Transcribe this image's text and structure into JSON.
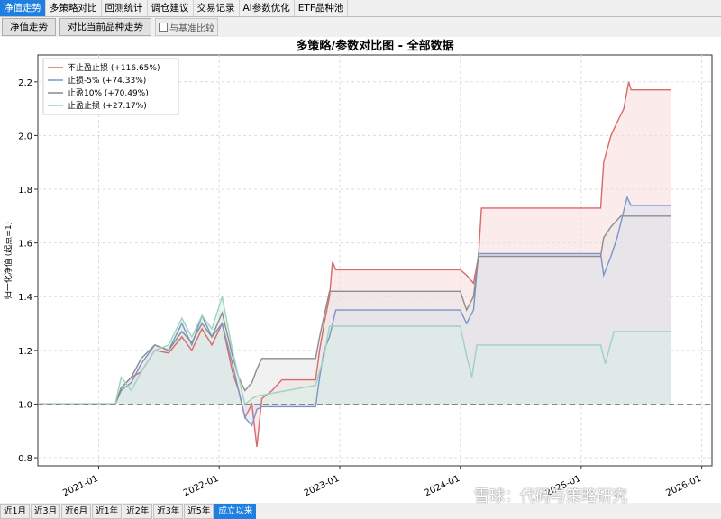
{
  "tabs": [
    {
      "label": "净值走势",
      "active": true
    },
    {
      "label": "多策略对比",
      "active": false
    },
    {
      "label": "回测统计",
      "active": false
    },
    {
      "label": "调仓建议",
      "active": false
    },
    {
      "label": "交易记录",
      "active": false
    },
    {
      "label": "AI参数优化",
      "active": false
    },
    {
      "label": "ETF品种池",
      "active": false
    }
  ],
  "toolbar": {
    "btn_nav": "净值走势",
    "btn_compare": "对比当前品种走势",
    "chk_benchmark": "与基准比较"
  },
  "ranges": [
    {
      "label": "近1月",
      "active": false
    },
    {
      "label": "近3月",
      "active": false
    },
    {
      "label": "近6月",
      "active": false
    },
    {
      "label": "近1年",
      "active": false
    },
    {
      "label": "近2年",
      "active": false
    },
    {
      "label": "近3年",
      "active": false
    },
    {
      "label": "近5年",
      "active": false
    },
    {
      "label": "成立以来",
      "active": true
    }
  ],
  "watermark": "雪球：代码与策略研究",
  "chart_data": {
    "type": "line",
    "title": "多策略/参数对比图 - 全部数据",
    "xlabel": "",
    "ylabel": "归一化净值 (起点=1)",
    "xlim": [
      "2020-07-01",
      "2026-02-01"
    ],
    "ylim": [
      0.77,
      2.3
    ],
    "yticks": [
      "0.8",
      "1.0",
      "1.2",
      "1.4",
      "1.6",
      "1.8",
      "2.0",
      "2.2"
    ],
    "xticks": [
      "2021-01",
      "2022-01",
      "2023-01",
      "2024-01",
      "2025-01",
      "2026-01"
    ],
    "baseline": 1.0,
    "grid": true,
    "legend_position": "top-left",
    "series": [
      {
        "name": "不止盈止损 (+116.65%)",
        "color": "#d9696b",
        "fill": "#f9dada",
        "points": [
          [
            "2020-07-01",
            1.0
          ],
          [
            "2021-02-20",
            1.0
          ],
          [
            "2021-03-10",
            1.06
          ],
          [
            "2021-04-10",
            1.1
          ],
          [
            "2021-05-10",
            1.12
          ],
          [
            "2021-06-20",
            1.2
          ],
          [
            "2021-08-01",
            1.19
          ],
          [
            "2021-09-10",
            1.25
          ],
          [
            "2021-10-10",
            1.2
          ],
          [
            "2021-11-10",
            1.28
          ],
          [
            "2021-12-10",
            1.22
          ],
          [
            "2022-01-10",
            1.3
          ],
          [
            "2022-02-10",
            1.12
          ],
          [
            "2022-03-01",
            1.05
          ],
          [
            "2022-03-20",
            0.95
          ],
          [
            "2022-04-10",
            1.0
          ],
          [
            "2022-04-25",
            0.84
          ],
          [
            "2022-05-10",
            1.02
          ],
          [
            "2022-06-10",
            1.05
          ],
          [
            "2022-07-10",
            1.09
          ],
          [
            "2022-10-20",
            1.09
          ],
          [
            "2022-11-01",
            1.2
          ],
          [
            "2022-11-15",
            1.3
          ],
          [
            "2022-12-01",
            1.4
          ],
          [
            "2022-12-10",
            1.53
          ],
          [
            "2022-12-20",
            1.5
          ],
          [
            "2024-01-01",
            1.5
          ],
          [
            "2024-01-20",
            1.48
          ],
          [
            "2024-02-10",
            1.45
          ],
          [
            "2024-02-25",
            1.55
          ],
          [
            "2024-03-05",
            1.73
          ],
          [
            "2025-03-01",
            1.73
          ],
          [
            "2025-03-10",
            1.9
          ],
          [
            "2025-04-01",
            2.0
          ],
          [
            "2025-04-20",
            2.05
          ],
          [
            "2025-05-10",
            2.1
          ],
          [
            "2025-05-25",
            2.2
          ],
          [
            "2025-06-01",
            2.17
          ],
          [
            "2025-10-01",
            2.17
          ]
        ]
      },
      {
        "name": "止损-5% (+74.33%)",
        "color": "#7a95c8",
        "fill": "#d8e0f2",
        "points": [
          [
            "2020-07-01",
            1.0
          ],
          [
            "2021-02-20",
            1.0
          ],
          [
            "2021-03-10",
            1.05
          ],
          [
            "2021-04-10",
            1.08
          ],
          [
            "2021-05-10",
            1.15
          ],
          [
            "2021-06-20",
            1.22
          ],
          [
            "2021-08-01",
            1.2
          ],
          [
            "2021-09-10",
            1.3
          ],
          [
            "2021-10-10",
            1.22
          ],
          [
            "2021-11-10",
            1.33
          ],
          [
            "2021-12-10",
            1.25
          ],
          [
            "2022-01-10",
            1.3
          ],
          [
            "2022-02-10",
            1.15
          ],
          [
            "2022-03-01",
            1.05
          ],
          [
            "2022-03-20",
            0.95
          ],
          [
            "2022-04-10",
            0.92
          ],
          [
            "2022-04-25",
            0.98
          ],
          [
            "2022-05-10",
            0.99
          ],
          [
            "2022-10-20",
            0.99
          ],
          [
            "2022-11-01",
            1.1
          ],
          [
            "2022-11-15",
            1.2
          ],
          [
            "2022-12-01",
            1.25
          ],
          [
            "2022-12-20",
            1.35
          ],
          [
            "2024-01-01",
            1.35
          ],
          [
            "2024-01-20",
            1.3
          ],
          [
            "2024-02-10",
            1.35
          ],
          [
            "2024-02-25",
            1.56
          ],
          [
            "2025-03-01",
            1.56
          ],
          [
            "2025-03-10",
            1.48
          ],
          [
            "2025-04-01",
            1.55
          ],
          [
            "2025-04-20",
            1.62
          ],
          [
            "2025-05-10",
            1.72
          ],
          [
            "2025-05-20",
            1.77
          ],
          [
            "2025-06-01",
            1.74
          ],
          [
            "2025-10-01",
            1.74
          ]
        ]
      },
      {
        "name": "止盈10% (+70.49%)",
        "color": "#8c8c8c",
        "fill": "#e6e6e6",
        "points": [
          [
            "2020-07-01",
            1.0
          ],
          [
            "2021-02-20",
            1.0
          ],
          [
            "2021-03-10",
            1.06
          ],
          [
            "2021-04-10",
            1.1
          ],
          [
            "2021-05-10",
            1.17
          ],
          [
            "2021-06-20",
            1.22
          ],
          [
            "2021-08-01",
            1.2
          ],
          [
            "2021-09-10",
            1.27
          ],
          [
            "2021-10-10",
            1.23
          ],
          [
            "2021-11-10",
            1.3
          ],
          [
            "2021-12-10",
            1.25
          ],
          [
            "2022-01-10",
            1.34
          ],
          [
            "2022-02-10",
            1.18
          ],
          [
            "2022-03-01",
            1.1
          ],
          [
            "2022-03-20",
            1.05
          ],
          [
            "2022-04-10",
            1.08
          ],
          [
            "2022-04-25",
            1.13
          ],
          [
            "2022-05-10",
            1.17
          ],
          [
            "2022-10-20",
            1.17
          ],
          [
            "2022-11-01",
            1.25
          ],
          [
            "2022-11-15",
            1.33
          ],
          [
            "2022-12-01",
            1.42
          ],
          [
            "2024-01-01",
            1.42
          ],
          [
            "2024-01-20",
            1.35
          ],
          [
            "2024-02-10",
            1.4
          ],
          [
            "2024-02-25",
            1.55
          ],
          [
            "2025-03-01",
            1.55
          ],
          [
            "2025-03-10",
            1.62
          ],
          [
            "2025-04-01",
            1.66
          ],
          [
            "2025-05-01",
            1.7
          ],
          [
            "2025-10-01",
            1.7
          ]
        ]
      },
      {
        "name": "止盈止损 (+27.17%)",
        "color": "#9fd2bf",
        "fill": "#d9efe6",
        "points": [
          [
            "2020-07-01",
            1.0
          ],
          [
            "2021-02-20",
            1.0
          ],
          [
            "2021-03-10",
            1.1
          ],
          [
            "2021-04-10",
            1.05
          ],
          [
            "2021-05-10",
            1.12
          ],
          [
            "2021-06-20",
            1.2
          ],
          [
            "2021-08-01",
            1.22
          ],
          [
            "2021-09-10",
            1.32
          ],
          [
            "2021-10-10",
            1.25
          ],
          [
            "2021-11-10",
            1.33
          ],
          [
            "2021-12-10",
            1.28
          ],
          [
            "2022-01-10",
            1.4
          ],
          [
            "2022-02-10",
            1.2
          ],
          [
            "2022-03-01",
            1.1
          ],
          [
            "2022-03-20",
            1.0
          ],
          [
            "2022-04-10",
            1.02
          ],
          [
            "2022-04-25",
            1.03
          ],
          [
            "2022-10-20",
            1.07
          ],
          [
            "2022-11-15",
            1.18
          ],
          [
            "2022-12-01",
            1.29
          ],
          [
            "2024-01-01",
            1.29
          ],
          [
            "2024-01-20",
            1.18
          ],
          [
            "2024-02-05",
            1.1
          ],
          [
            "2024-02-20",
            1.22
          ],
          [
            "2025-03-01",
            1.22
          ],
          [
            "2025-03-15",
            1.15
          ],
          [
            "2025-04-10",
            1.27
          ],
          [
            "2025-10-01",
            1.27
          ]
        ]
      }
    ]
  }
}
